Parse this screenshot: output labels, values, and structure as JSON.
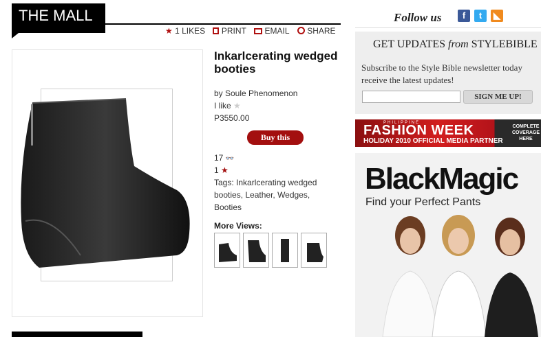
{
  "header": {
    "section_title": "THE MALL",
    "actions": [
      {
        "icon": "star-icon",
        "label": "1 LIKES"
      },
      {
        "icon": "print-icon",
        "label": "PRINT"
      },
      {
        "icon": "email-icon",
        "label": "EMAIL"
      },
      {
        "icon": "share-icon",
        "label": "SHARE"
      }
    ]
  },
  "product": {
    "title": "Inkarlcerating wedged booties",
    "byline": "by Soule Phenomenon",
    "like_label": "I like",
    "price": "P3550.00",
    "buy_label": "Buy this",
    "views_count": "17",
    "stars_count": "1",
    "tags_text": "Tags: Inkarlcerating wedged booties, Leather, Wedges, Booties",
    "more_views_label": "More Views:"
  },
  "sidebar": {
    "follow_label": "Follow us",
    "social": [
      {
        "icon": "facebook-icon",
        "glyph": "f",
        "color": "#3b5998"
      },
      {
        "icon": "twitter-icon",
        "glyph": "t",
        "color": "#33aaf0"
      },
      {
        "icon": "rss-icon",
        "glyph": "◣",
        "color": "#f08a1e"
      }
    ],
    "updates_title_a": "GET UPDATES ",
    "updates_title_b": "from",
    "updates_title_c": " STYLEBIBLE",
    "updates_text": "Subscribe to the Style Bible newsletter today receive the latest updates!",
    "signup_label": "SIGN ME UP!",
    "fw_small": "PHILIPPINE",
    "fw_title": "FASHION WEEK",
    "fw_sub": "HOLIDAY 2010 OFFICIAL MEDIA PARTNER",
    "fw_right": "COMPLETE COVERAGE HERE",
    "ad_title": "BlackMagic",
    "ad_sub": "Find your Perfect Pants"
  },
  "colors": {
    "accent_red": "#a30f0f",
    "banner_red": "#d21e1e"
  }
}
